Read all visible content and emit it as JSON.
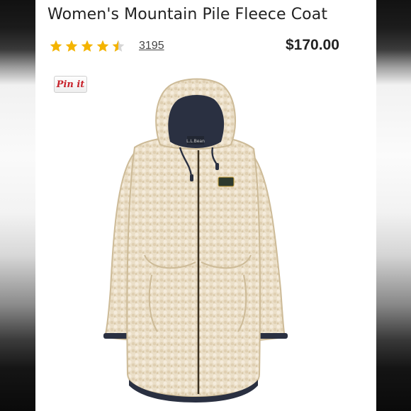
{
  "product": {
    "title": "Women's Mountain Pile Fleece Coat",
    "rating": 4.5,
    "rating_max": 5,
    "review_count": "3195",
    "price": "$170.00",
    "image_alt": "Women's Mountain Pile Fleece Coat",
    "star_icon": "star-icon"
  },
  "pinterest": {
    "label": "Pin it"
  },
  "colors": {
    "star": "#f4b400",
    "star_empty": "#d6d6d6",
    "pin_text": "#c8232c",
    "coat": "#e9dcc4",
    "lining": "#2a3041"
  }
}
